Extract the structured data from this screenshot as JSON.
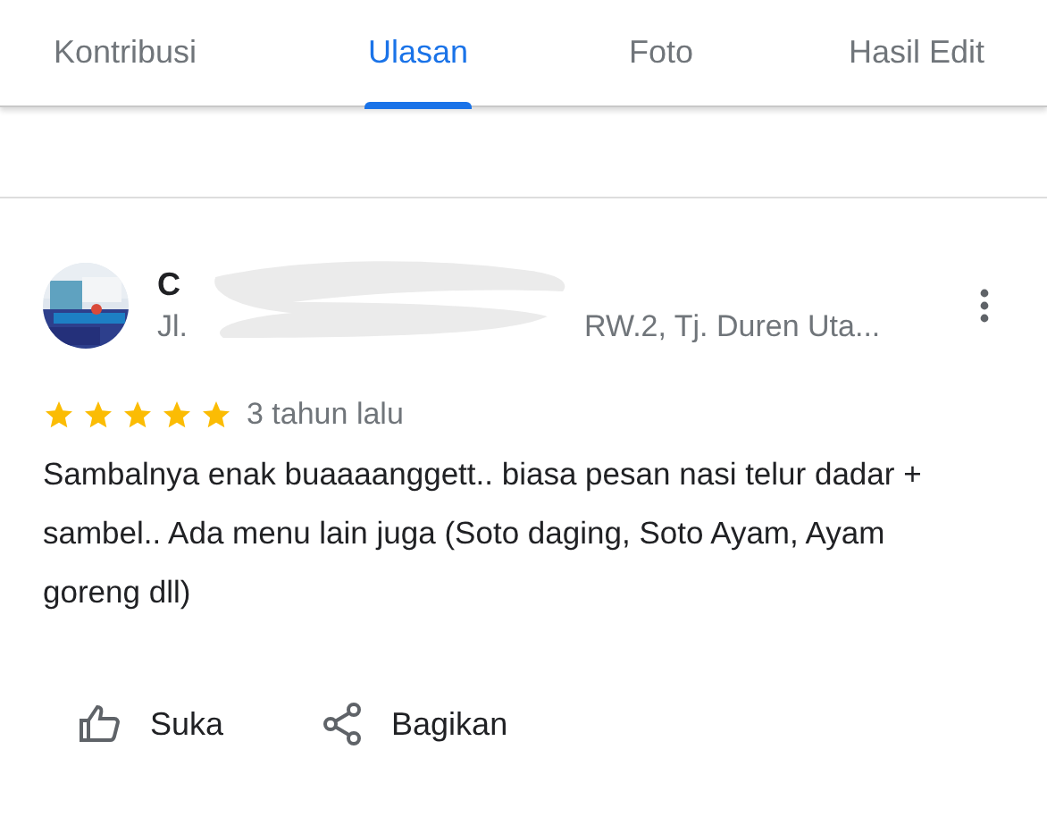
{
  "tabs": [
    {
      "label": "Kontribusi",
      "selected": false
    },
    {
      "label": "Ulasan",
      "selected": true
    },
    {
      "label": "Foto",
      "selected": false
    },
    {
      "label": "Hasil Edit",
      "selected": false
    }
  ],
  "review": {
    "author": "C",
    "address_start": "Jl.",
    "address_end": "RW.2, Tj. Duren Uta...",
    "stars": 5,
    "time": "3 tahun lalu",
    "text": "Sambalnya enak buaaaanggett.. biasa pesan nasi telur dadar + sambel..  Ada menu lain juga (Soto daging, Soto Ayam, Ayam goreng dll)",
    "actions": [
      {
        "kind": "like",
        "label": "Suka"
      },
      {
        "kind": "share",
        "label": "Bagikan"
      }
    ]
  }
}
